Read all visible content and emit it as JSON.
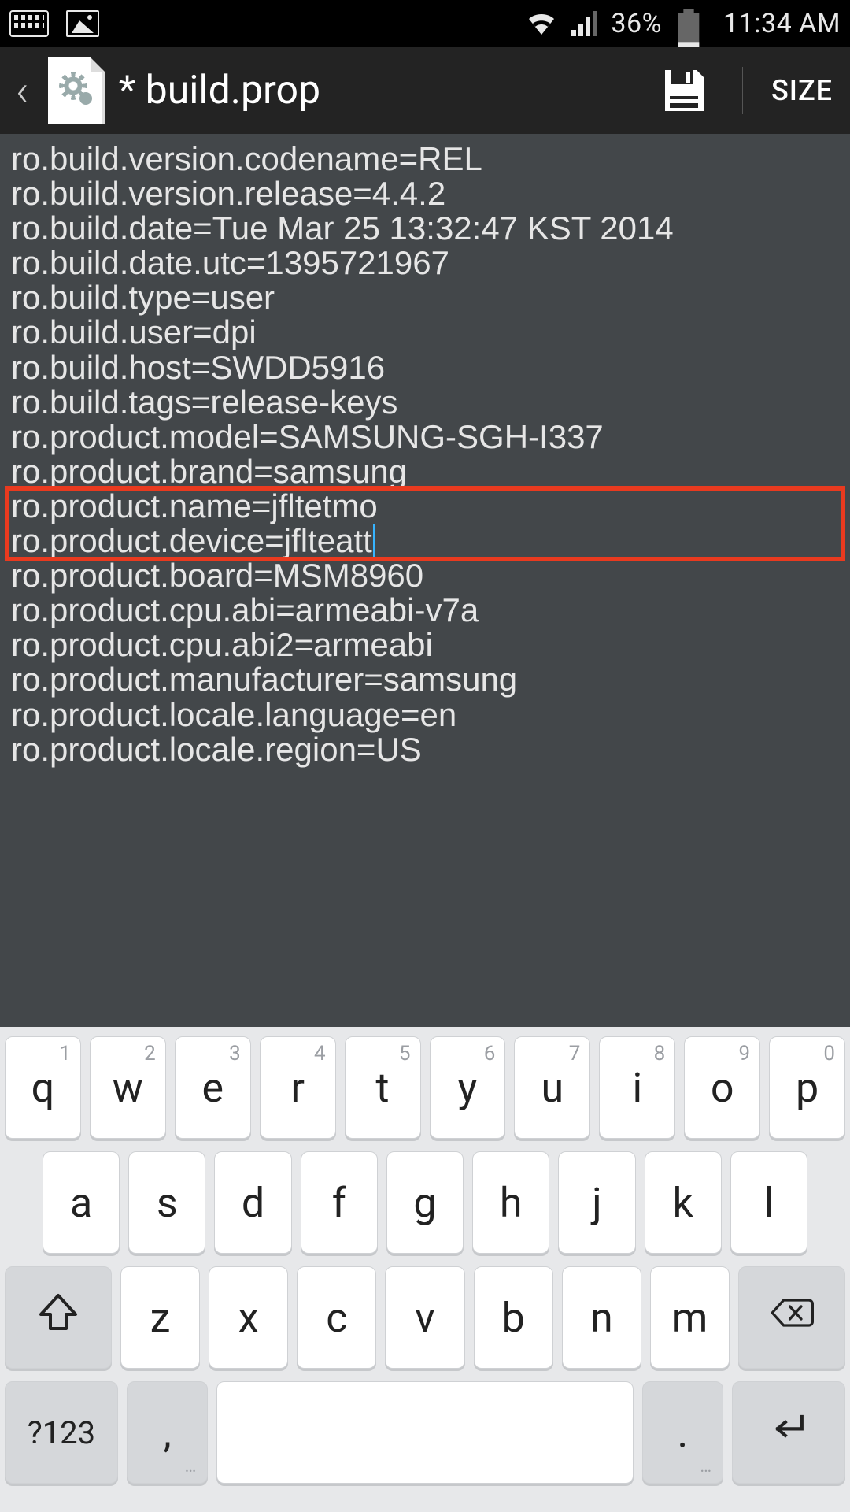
{
  "status_bar": {
    "battery_pct": "36%",
    "time": "11:34 AM"
  },
  "app_bar": {
    "title": "* build.prop",
    "size_label": "SIZE"
  },
  "editor": {
    "lines": [
      "ro.build.version.codename=REL",
      "ro.build.version.release=4.4.2",
      "ro.build.date=Tue Mar 25 13:32:47 KST 2014",
      "ro.build.date.utc=1395721967",
      "ro.build.type=user",
      "ro.build.user=dpi",
      "ro.build.host=SWDD5916",
      "ro.build.tags=release-keys",
      "ro.product.model=SAMSUNG-SGH-I337",
      "ro.product.brand=samsung",
      "ro.product.name=jfltetmo",
      "ro.product.device=jflteatt",
      "ro.product.board=MSM8960",
      "ro.product.cpu.abi=armeabi-v7a",
      "ro.product.cpu.abi2=armeabi",
      "ro.product.manufacturer=samsung",
      "ro.product.locale.language=en",
      "ro.product.locale.region=US"
    ],
    "highlight_start_line": 10,
    "highlight_end_line": 11,
    "cursor_line": 11
  },
  "keyboard": {
    "row1": [
      {
        "k": "q",
        "n": "1"
      },
      {
        "k": "w",
        "n": "2"
      },
      {
        "k": "e",
        "n": "3"
      },
      {
        "k": "r",
        "n": "4"
      },
      {
        "k": "t",
        "n": "5"
      },
      {
        "k": "y",
        "n": "6"
      },
      {
        "k": "u",
        "n": "7"
      },
      {
        "k": "i",
        "n": "8"
      },
      {
        "k": "o",
        "n": "9"
      },
      {
        "k": "p",
        "n": "0"
      }
    ],
    "row2": [
      "a",
      "s",
      "d",
      "f",
      "g",
      "h",
      "j",
      "k",
      "l"
    ],
    "row3_letters": [
      "z",
      "x",
      "c",
      "v",
      "b",
      "n",
      "m"
    ],
    "sym_label": "?123",
    "comma": ",",
    "period": "."
  },
  "highlight_color": "#e93a1f"
}
